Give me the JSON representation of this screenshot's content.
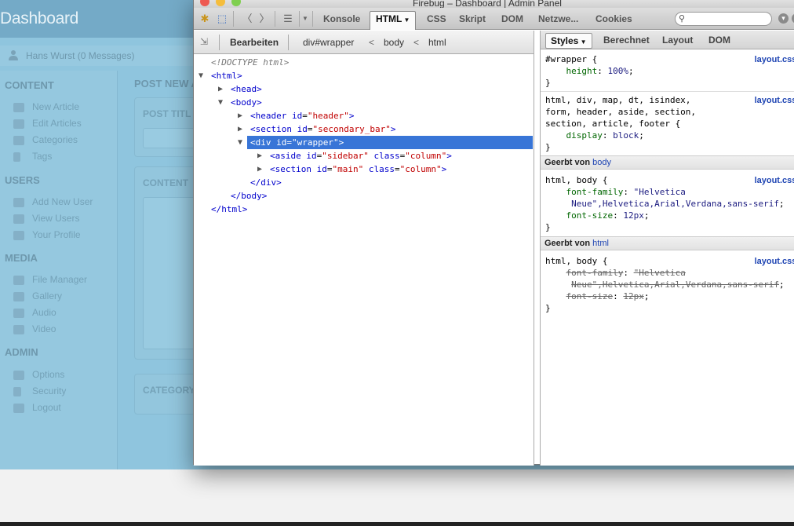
{
  "background": {
    "title": "Dashboard",
    "user": "Hans Wurst (0 Messages)",
    "sections": [
      {
        "label": "CONTENT",
        "items": [
          "New Article",
          "Edit Articles",
          "Categories",
          "Tags"
        ]
      },
      {
        "label": "USERS",
        "items": [
          "Add New User",
          "View Users",
          "Your Profile"
        ]
      },
      {
        "label": "MEDIA",
        "items": [
          "File Manager",
          "Gallery",
          "Audio",
          "Video"
        ]
      },
      {
        "label": "ADMIN",
        "items": [
          "Options",
          "Security",
          "Logout"
        ]
      }
    ],
    "main_heading": "POST NEW A",
    "box_labels": [
      "POST TITL",
      "CONTENT",
      "CATEGORY"
    ]
  },
  "window": {
    "title": "Firebug – Dashboard | Admin Panel"
  },
  "toolbar": {
    "tabs": [
      "Konsole",
      "HTML",
      "CSS",
      "Skript",
      "DOM",
      "Netzwe...",
      "Cookies"
    ],
    "active_tab": "HTML"
  },
  "breadcrumb": {
    "edit": "Bearbeiten",
    "path": [
      "div#wrapper",
      "body",
      "html"
    ]
  },
  "tree": {
    "doctype": "<!DOCTYPE html>",
    "html_open": "<html>",
    "head": "<head>",
    "body_open": "<body>",
    "header": {
      "tag": "header",
      "attr": "id",
      "val": "header"
    },
    "section": {
      "tag": "section",
      "attr": "id",
      "val": "secondary_bar"
    },
    "wrapper": "<div id=\"wrapper\">",
    "aside": {
      "tag": "aside",
      "attr1": "id",
      "val1": "sidebar",
      "attr2": "class",
      "val2": "column"
    },
    "main": {
      "tag": "section",
      "attr1": "id",
      "val1": "main",
      "attr2": "class",
      "val2": "column"
    },
    "div_close": "</div>",
    "body_close": "</body>",
    "html_close": "</html>"
  },
  "side_tabs": [
    "Styles",
    "Berechnet",
    "Layout",
    "DOM"
  ],
  "styles": {
    "source": "layout.css (Zei",
    "rule1": {
      "selector": "#wrapper {",
      "prop": "height",
      "val": "100%"
    },
    "rule2": {
      "selector1": "html, div, map, dt, isindex,",
      "selector2": "form, header, aside, section,",
      "selector3": "section, article, footer {",
      "prop": "display",
      "val": "block"
    },
    "inherited_prefix": "Geerbt von",
    "inherit1": "body",
    "rule3": {
      "selector": "html, body {",
      "prop1": "font-family",
      "val1a": "\"Helvetica",
      "val1b": "Neue\",Helvetica,Arial,Verdana,sans-serif",
      "prop2": "font-size",
      "val2": "12px"
    },
    "inherit2": "html",
    "rule4": {
      "selector": "html, body {",
      "prop1": "font-family",
      "val1a": "\"Helvetica",
      "val1b": "Neue\",Helvetica,Arial,Verdana,sans-serif",
      "prop2": "font-size",
      "val2": "12px"
    },
    "close": "}"
  }
}
